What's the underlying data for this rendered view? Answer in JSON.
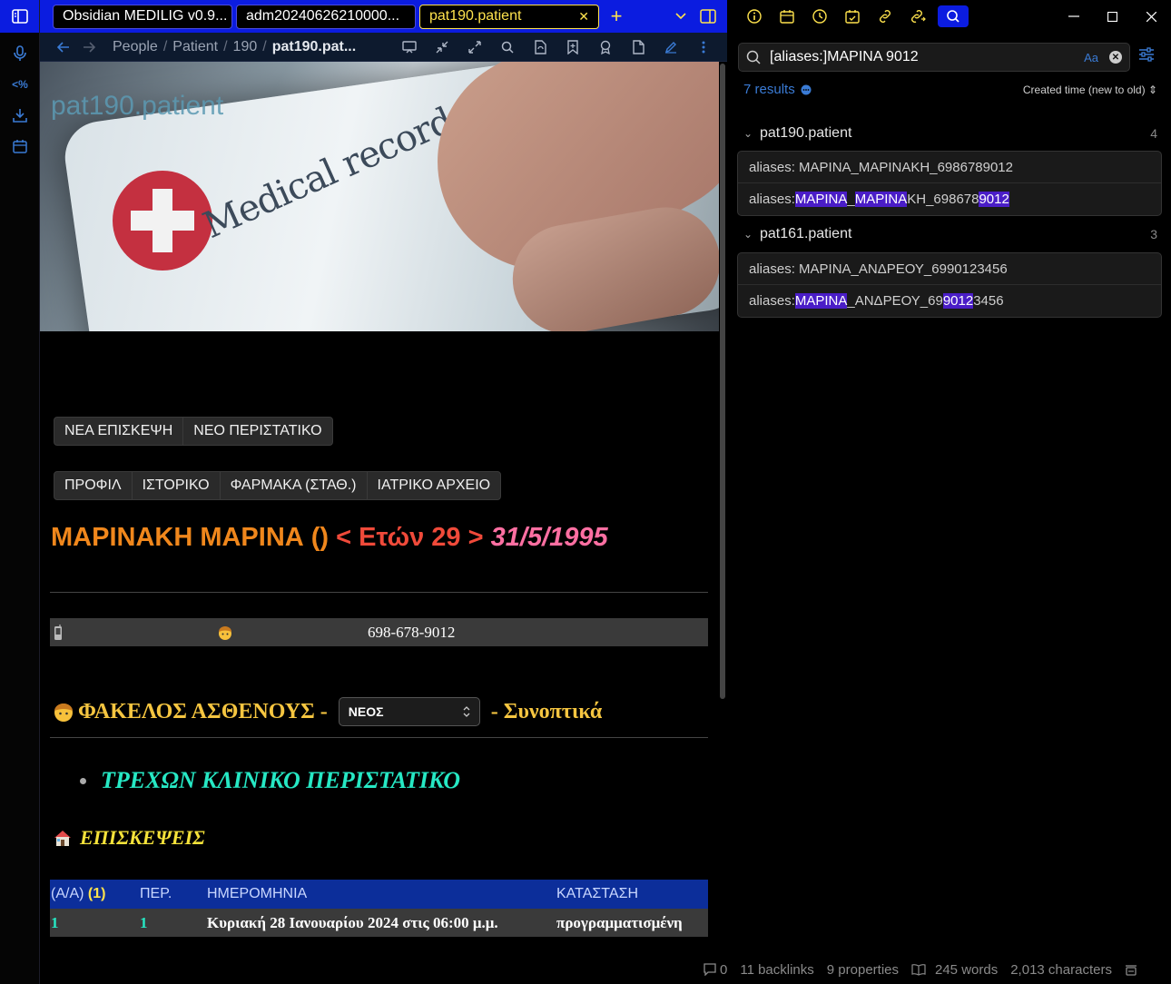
{
  "ribbon": {
    "icons": [
      "sidebar-toggle-icon",
      "microphone-icon",
      "code-icon",
      "download-icon",
      "calendar-icon"
    ],
    "code_label": "<%"
  },
  "tabs": [
    {
      "label": "Obsidian MEDILIG v0.9..."
    },
    {
      "label": "adm20240626210000..."
    },
    {
      "label": "pat190.patient",
      "active": true
    }
  ],
  "tab_close": "✕",
  "tab_add": "+",
  "nav": {
    "breadcrumbs": [
      "People",
      "Patient",
      "190"
    ],
    "current": "pat190.pat...",
    "sep": "/"
  },
  "note": {
    "banner_title": "pat190.patient",
    "banner_text": "Medical record",
    "buttons_row1": [
      "ΝΕΑ ΕΠΙΣΚΕΨΗ",
      "ΝΕΟ ΠΕΡΙΣΤΑΤΙΚΟ"
    ],
    "buttons_row2": [
      "ΠΡΟΦΙΛ",
      "ΙΣΤΟΡΙΚΟ",
      "ΦΑΡΜΑΚΑ (ΣΤΑΘ.)",
      "ΙΑΤΡΙΚΟ ΑΡΧΕΙΟ"
    ],
    "patient_name": "ΜΑΡΙΝΑΚΗ ΜΑΡΙΝΑ ()",
    "age": " < Ετών 29 > ",
    "dob": "31/5/1995",
    "phone": "698-678-9012",
    "folder_label": "ΦΑΚΕΛΟΣ ΑΣΘΕΝΟΥΣ -",
    "folder_select": "ΝΕΟΣ",
    "folder_suffix": "- Συνοπτικά",
    "current_case": "ΤΡΕΧΩΝ ΚΛΙΝΙΚΟ ΠΕΡΙΣΤΑΤΙΚΟ",
    "visits_label": "ΕΠΙΣΚΕΨΕΙΣ",
    "table": {
      "headers": [
        "(Α/Α)",
        "(1)",
        "ΠΕΡ.",
        "ΗΜΕΡΟΜΗΝΙΑ",
        "ΚΑΤΑΣΤΑΣΗ"
      ],
      "rows": [
        [
          "1",
          "1",
          "Κυριακή 28 Ιανουαρίου 2024 στις 06:00 μ.μ.",
          "προγραμματισμένη"
        ]
      ]
    }
  },
  "search": {
    "query": "[aliases:]ΜΑΡΙΝΑ 9012",
    "match_case": "Aa",
    "results_count": "7 results",
    "sort": "Created time (new to old)",
    "groups": [
      {
        "file": "pat190.patient",
        "count": "4",
        "matches": [
          [
            {
              "t": "aliases: ΜΑΡΙΝΑ_ΜΑΡΙΝΑΚΗ_6986789012",
              "h": false
            }
          ],
          [
            {
              "t": "aliases: ",
              "h": false
            },
            {
              "t": "ΜΑΡΙΝΑ",
              "h": true
            },
            {
              "t": "_",
              "h": false
            },
            {
              "t": "ΜΑΡΙΝΑ",
              "h": true
            },
            {
              "t": "ΚΗ_698678",
              "h": false
            },
            {
              "t": "9012",
              "h": true
            }
          ]
        ]
      },
      {
        "file": "pat161.patient",
        "count": "3",
        "matches": [
          [
            {
              "t": "aliases: ΜΑΡΙΝΑ_ΑΝΔΡΕΟΥ_6990123456",
              "h": false
            }
          ],
          [
            {
              "t": "aliases: ",
              "h": false
            },
            {
              "t": "ΜΑΡΙΝΑ",
              "h": true
            },
            {
              "t": "_ΑΝΔΡΕΟΥ_69",
              "h": false
            },
            {
              "t": "9012",
              "h": true
            },
            {
              "t": "3456",
              "h": false
            }
          ]
        ]
      }
    ]
  },
  "status": {
    "comments": "0",
    "backlinks": "11 backlinks",
    "properties": "9 properties",
    "words": "245 words",
    "chars": "2,013 characters"
  },
  "colors": {
    "accent": "#0b1ce0",
    "tab_active": "#ffe34d",
    "name": "#f0871c",
    "age": "#f04a3a",
    "dob": "#ff6fa2",
    "highlight": "#4a1dc7"
  }
}
